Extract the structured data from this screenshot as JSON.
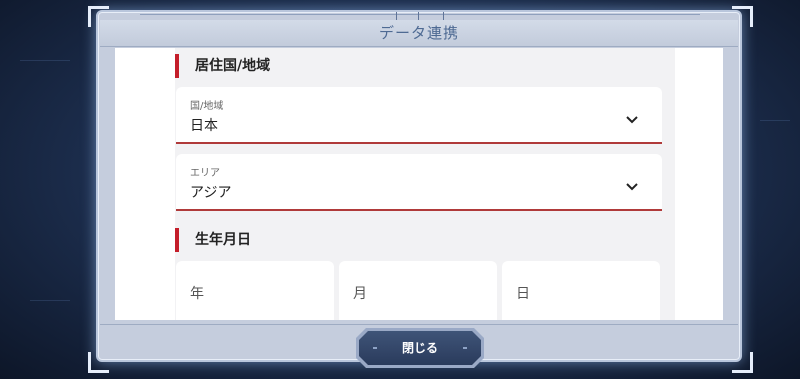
{
  "dialog": {
    "title": "データ連携",
    "close_label": "閉じる"
  },
  "sections": {
    "residence": {
      "title": "居住国/地域",
      "country": {
        "label": "国/地域",
        "value": "日本"
      },
      "area": {
        "label": "エリア",
        "value": "アジア"
      }
    },
    "birthdate": {
      "title": "生年月日",
      "year_placeholder": "年",
      "month_placeholder": "月",
      "day_placeholder": "日"
    }
  },
  "colors": {
    "accent": "#c41e2a",
    "field_underline": "#b03a3a",
    "title_text": "#4e6a93",
    "button_bg": "#2f4264"
  },
  "icons": [
    "chevron-down-icon"
  ]
}
